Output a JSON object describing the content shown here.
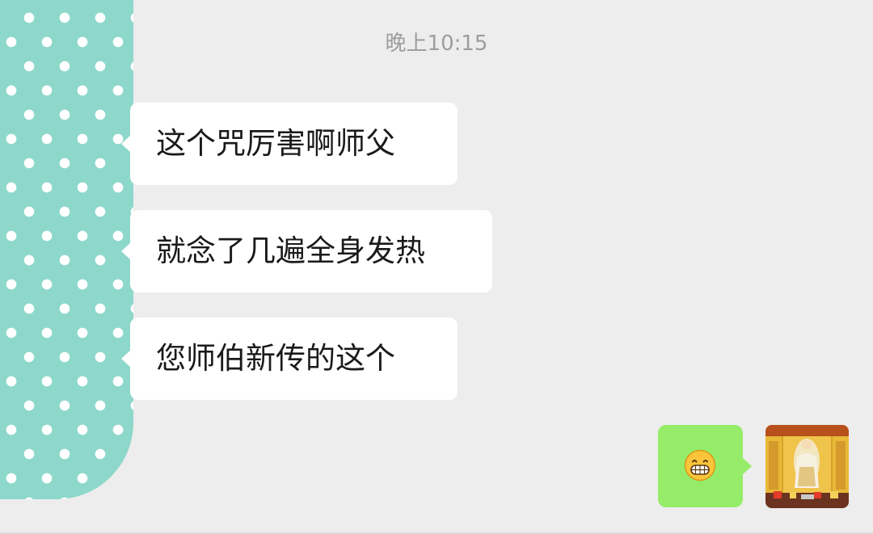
{
  "timestamp": "晚上10:15",
  "messages_in": [
    {
      "text": "这个咒厉害啊师父"
    },
    {
      "text": "就念了几遍全身发热"
    },
    {
      "text": "您师伯新传的这个"
    }
  ],
  "message_out": {
    "type": "emoji",
    "emoji": "grinning-face-icon"
  },
  "colors": {
    "background": "#ededed",
    "bubble_incoming": "#ffffff",
    "bubble_outgoing": "#95ec69",
    "timestamp": "#9d9d9d",
    "avatar_left": "#8dd8cb"
  }
}
